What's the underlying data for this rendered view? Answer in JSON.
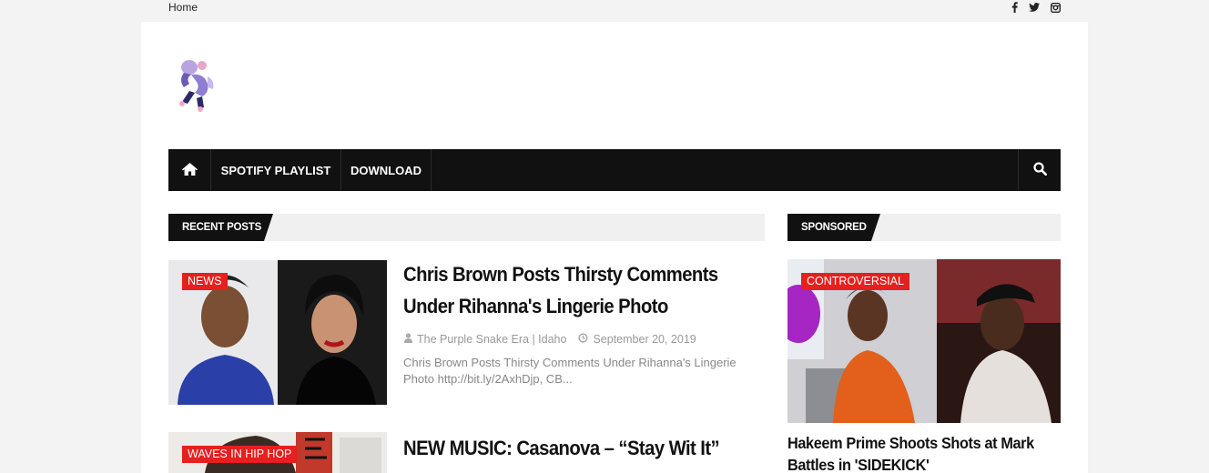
{
  "topbar": {
    "home_label": "Home",
    "social_icons": [
      "facebook-icon",
      "twitter-icon",
      "instagram-icon"
    ]
  },
  "nav": {
    "home_icon": "home-icon",
    "items": [
      {
        "label": "SPOTIFY PLAYLIST"
      },
      {
        "label": "DOWNLOAD"
      }
    ],
    "search_icon": "search-icon"
  },
  "recent_posts": {
    "heading": "RECENT POSTS",
    "posts": [
      {
        "category": "NEWS",
        "title_line1": "Chris Brown Posts Thirsty Comments",
        "title_line2": "Under Rihanna's Lingerie Photo",
        "author": "The Purple Snake Era | Idaho",
        "date": "September 20, 2019",
        "excerpt_line1": "Chris Brown Posts Thirsty Comments Under Rihanna's Lingerie",
        "excerpt_line2": "Photo http://bit.ly/2AxhDjp, CB..."
      },
      {
        "category": "WAVES IN HIP HOP",
        "title_line1": "NEW MUSIC: Casanova – “Stay Wit It”"
      }
    ]
  },
  "sponsored": {
    "heading": "SPONSORED",
    "post": {
      "category": "CONTROVERSIAL",
      "title_line1": "Hakeem Prime Shoots Shots at Mark",
      "title_line2": "Battles in 'SIDEKICK'"
    }
  },
  "colors": {
    "accent": "#e61f1f",
    "nav_bg": "#111111",
    "page_bg": "#f3f3f3"
  }
}
